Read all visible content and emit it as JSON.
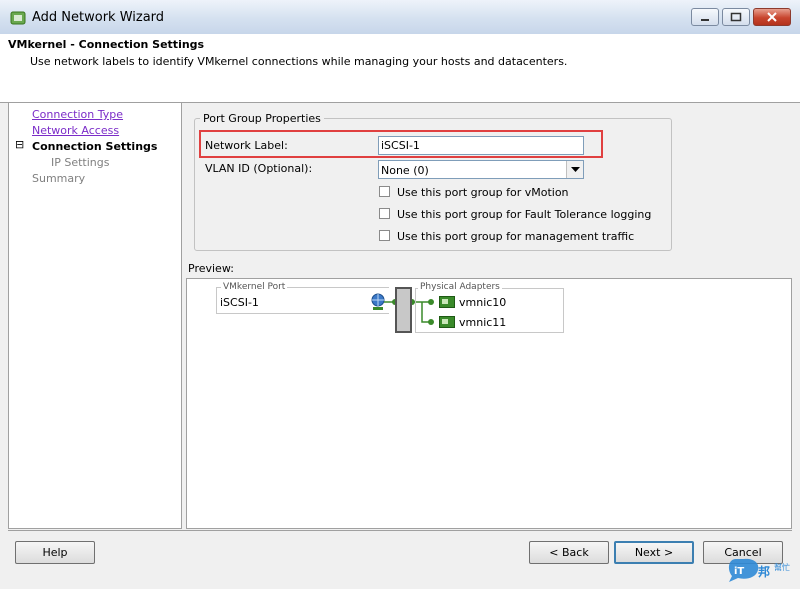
{
  "window": {
    "title": "Add Network Wizard",
    "icon": "network-wizard-icon",
    "controls": [
      "minimize-icon",
      "maximize-icon",
      "close-icon"
    ]
  },
  "header": {
    "title": "VMkernel - Connection Settings",
    "subtitle": "Use network labels to identify VMkernel connections while managing your hosts and datacenters."
  },
  "nav": {
    "items": [
      {
        "label": "Connection Type",
        "state": "link"
      },
      {
        "label": "Network Access",
        "state": "link"
      },
      {
        "label": "Connection Settings",
        "state": "current"
      },
      {
        "label": "IP Settings",
        "state": "disabled"
      },
      {
        "label": "Summary",
        "state": "disabled"
      }
    ],
    "collapse_glyph": "⊟"
  },
  "port_group": {
    "legend": "Port Group Properties",
    "network_label_caption": "Network Label:",
    "network_label_value": "iSCSI-1",
    "vlan_caption": "VLAN ID (Optional):",
    "vlan_value": "None (0)",
    "checkboxes": [
      {
        "label": "Use this port group for vMotion",
        "checked": false
      },
      {
        "label": "Use this port group for Fault Tolerance logging",
        "checked": false
      },
      {
        "label": "Use this port group for management traffic",
        "checked": false
      }
    ]
  },
  "preview": {
    "caption": "Preview:",
    "vmkernel_caption": "VMkernel Port",
    "vmkernel_port": "iSCSI-1",
    "adapters_caption": "Physical Adapters",
    "adapters": [
      "vmnic10",
      "vmnic11"
    ]
  },
  "buttons": {
    "help": "Help",
    "back": "< Back",
    "next": "Next >",
    "cancel": "Cancel"
  },
  "watermark": {
    "text": "iT邦幫忙"
  },
  "colors": {
    "accent_highlight": "#e04040",
    "link": "#7b2cc8",
    "link_color_focus_border": "#3c7fb1",
    "nic_green": "#3a8a2a"
  }
}
